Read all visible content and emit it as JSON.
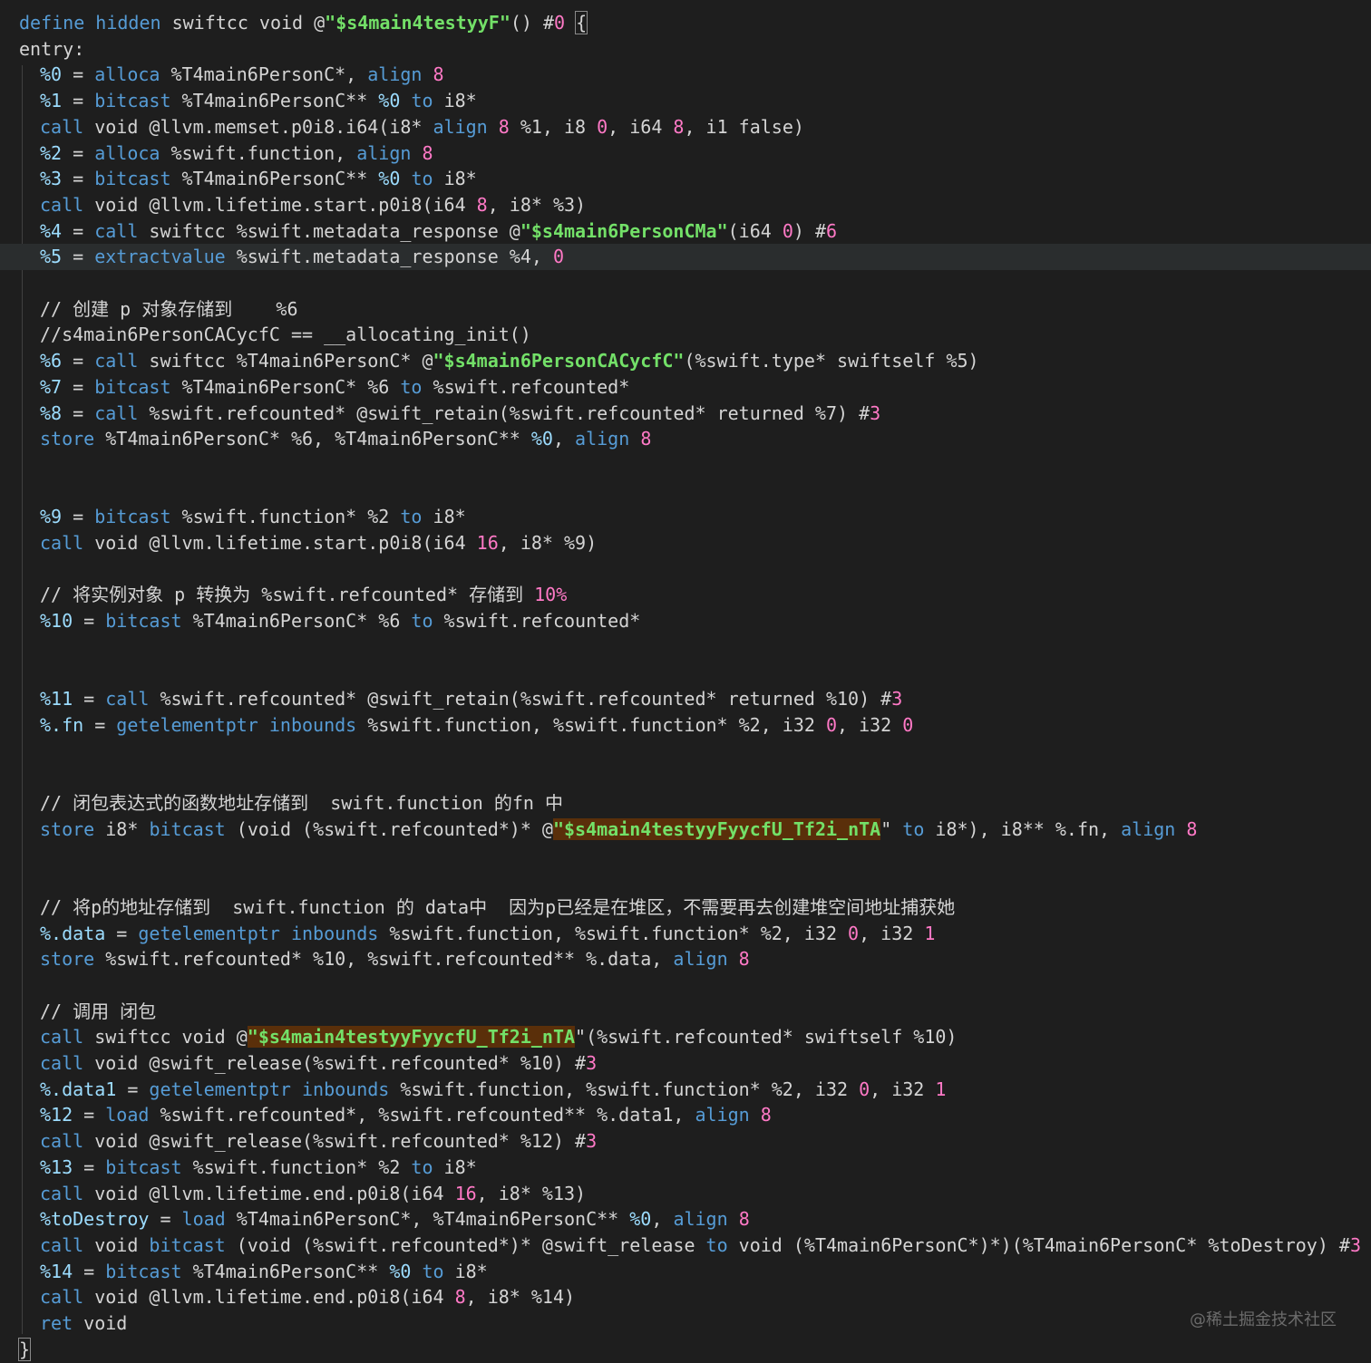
{
  "watermark": "@稀土掘金技术社区",
  "lines": [
    {
      "row": 0,
      "indent": false,
      "tokens": [
        [
          "kw",
          "define hidden"
        ],
        [
          "plain",
          " swiftcc void @"
        ],
        [
          "fn",
          "\"$s4main4testyyF\""
        ],
        [
          "plain",
          "() #"
        ],
        [
          "num",
          "0"
        ],
        [
          "plain",
          " "
        ],
        [
          "br",
          "{"
        ]
      ]
    },
    {
      "row": 1,
      "indent": false,
      "tokens": [
        [
          "plain",
          "entry:"
        ]
      ]
    },
    {
      "row": 2,
      "indent": true,
      "tokens": [
        [
          "var",
          "%0"
        ],
        [
          "plain",
          " = "
        ],
        [
          "kw",
          "alloca"
        ],
        [
          "plain",
          " %T4main6PersonC*, "
        ],
        [
          "kw",
          "align"
        ],
        [
          "plain",
          " "
        ],
        [
          "num",
          "8"
        ]
      ]
    },
    {
      "row": 3,
      "indent": true,
      "tokens": [
        [
          "var",
          "%1"
        ],
        [
          "plain",
          " = "
        ],
        [
          "kw",
          "bitcast"
        ],
        [
          "plain",
          " %T4main6PersonC** "
        ],
        [
          "var",
          "%0"
        ],
        [
          "plain",
          " "
        ],
        [
          "kw",
          "to"
        ],
        [
          "plain",
          " i8*"
        ]
      ]
    },
    {
      "row": 4,
      "indent": true,
      "tokens": [
        [
          "kw",
          "call"
        ],
        [
          "plain",
          " void @llvm.memset.p0i8.i64(i8* "
        ],
        [
          "kw",
          "align"
        ],
        [
          "plain",
          " "
        ],
        [
          "num",
          "8"
        ],
        [
          "plain",
          " %1, i8 "
        ],
        [
          "num",
          "0"
        ],
        [
          "plain",
          ", i64 "
        ],
        [
          "num",
          "8"
        ],
        [
          "plain",
          ", i1 false)"
        ]
      ]
    },
    {
      "row": 5,
      "indent": true,
      "tokens": [
        [
          "var",
          "%2"
        ],
        [
          "plain",
          " = "
        ],
        [
          "kw",
          "alloca"
        ],
        [
          "plain",
          " %swift.function, "
        ],
        [
          "kw",
          "align"
        ],
        [
          "plain",
          " "
        ],
        [
          "num",
          "8"
        ]
      ]
    },
    {
      "row": 6,
      "indent": true,
      "tokens": [
        [
          "var",
          "%3"
        ],
        [
          "plain",
          " = "
        ],
        [
          "kw",
          "bitcast"
        ],
        [
          "plain",
          " %T4main6PersonC** "
        ],
        [
          "var",
          "%0"
        ],
        [
          "plain",
          " "
        ],
        [
          "kw",
          "to"
        ],
        [
          "plain",
          " i8*"
        ]
      ]
    },
    {
      "row": 7,
      "indent": true,
      "tokens": [
        [
          "kw",
          "call"
        ],
        [
          "plain",
          " void @llvm.lifetime.start.p0i8(i64 "
        ],
        [
          "num",
          "8"
        ],
        [
          "plain",
          ", i8* %3)"
        ]
      ]
    },
    {
      "row": 8,
      "indent": true,
      "tokens": [
        [
          "var",
          "%4"
        ],
        [
          "plain",
          " = "
        ],
        [
          "kw",
          "call"
        ],
        [
          "plain",
          " swiftcc %swift.metadata_response @"
        ],
        [
          "fn",
          "\"$s4main6PersonCMa\""
        ],
        [
          "plain",
          "(i64 "
        ],
        [
          "num",
          "0"
        ],
        [
          "plain",
          ") #"
        ],
        [
          "num",
          "6"
        ]
      ]
    },
    {
      "row": 9,
      "indent": true,
      "current": true,
      "tokens": [
        [
          "var",
          "%5"
        ],
        [
          "plain",
          " = "
        ],
        [
          "kw",
          "extractvalue"
        ],
        [
          "plain",
          " %swift.metadata_response %4, "
        ],
        [
          "num",
          "0"
        ]
      ]
    },
    {
      "row": 11,
      "indent": true,
      "tokens": [
        [
          "cm",
          "// 创建 p 对象存储到    %6"
        ]
      ]
    },
    {
      "row": 12,
      "indent": true,
      "tokens": [
        [
          "cm",
          "//s4main6PersonCACycfC == __allocating_init()"
        ]
      ]
    },
    {
      "row": 13,
      "indent": true,
      "tokens": [
        [
          "var",
          "%6"
        ],
        [
          "plain",
          " = "
        ],
        [
          "kw",
          "call"
        ],
        [
          "plain",
          " swiftcc %T4main6PersonC* @"
        ],
        [
          "fn",
          "\"$s4main6PersonCACycfC\""
        ],
        [
          "plain",
          "(%swift.type* swiftself %5)"
        ]
      ]
    },
    {
      "row": 14,
      "indent": true,
      "tokens": [
        [
          "var",
          "%7"
        ],
        [
          "plain",
          " = "
        ],
        [
          "kw",
          "bitcast"
        ],
        [
          "plain",
          " %T4main6PersonC* %6 "
        ],
        [
          "kw",
          "to"
        ],
        [
          "plain",
          " %swift.refcounted*"
        ]
      ]
    },
    {
      "row": 15,
      "indent": true,
      "tokens": [
        [
          "var",
          "%8"
        ],
        [
          "plain",
          " = "
        ],
        [
          "kw",
          "call"
        ],
        [
          "plain",
          " %swift.refcounted* @swift_retain(%swift.refcounted* returned %7) #"
        ],
        [
          "num",
          "3"
        ]
      ]
    },
    {
      "row": 16,
      "indent": true,
      "tokens": [
        [
          "kw",
          "store"
        ],
        [
          "plain",
          " %T4main6PersonC* %6, %T4main6PersonC** "
        ],
        [
          "var",
          "%0"
        ],
        [
          "plain",
          ", "
        ],
        [
          "kw",
          "align"
        ],
        [
          "plain",
          " "
        ],
        [
          "num",
          "8"
        ]
      ]
    },
    {
      "row": 19,
      "indent": true,
      "tokens": [
        [
          "var",
          "%9"
        ],
        [
          "plain",
          " = "
        ],
        [
          "kw",
          "bitcast"
        ],
        [
          "plain",
          " %swift.function* %2 "
        ],
        [
          "kw",
          "to"
        ],
        [
          "plain",
          " i8*"
        ]
      ]
    },
    {
      "row": 20,
      "indent": true,
      "tokens": [
        [
          "kw",
          "call"
        ],
        [
          "plain",
          " void @llvm.lifetime.start.p0i8(i64 "
        ],
        [
          "num",
          "16"
        ],
        [
          "plain",
          ", i8* %9)"
        ]
      ]
    },
    {
      "row": 22,
      "indent": true,
      "tokens": [
        [
          "cm",
          "// 将实例对象 p 转换为 %swift.refcounted* 存储到 "
        ],
        [
          "num",
          "10%"
        ]
      ]
    },
    {
      "row": 23,
      "indent": true,
      "tokens": [
        [
          "var",
          "%10"
        ],
        [
          "plain",
          " = "
        ],
        [
          "kw",
          "bitcast"
        ],
        [
          "plain",
          " %T4main6PersonC* %6 "
        ],
        [
          "kw",
          "to"
        ],
        [
          "plain",
          " %swift.refcounted*"
        ]
      ]
    },
    {
      "row": 26,
      "indent": true,
      "tokens": [
        [
          "var",
          "%11"
        ],
        [
          "plain",
          " = "
        ],
        [
          "kw",
          "call"
        ],
        [
          "plain",
          " %swift.refcounted* @swift_retain(%swift.refcounted* returned %10) #"
        ],
        [
          "num",
          "3"
        ]
      ]
    },
    {
      "row": 27,
      "indent": true,
      "tokens": [
        [
          "var",
          "%.fn"
        ],
        [
          "plain",
          " = "
        ],
        [
          "kw",
          "getelementptr inbounds"
        ],
        [
          "plain",
          " %swift.function, %swift.function* %2, i32 "
        ],
        [
          "num",
          "0"
        ],
        [
          "plain",
          ", i32 "
        ],
        [
          "num",
          "0"
        ]
      ]
    },
    {
      "row": 30,
      "indent": true,
      "tokens": [
        [
          "cm",
          "// 闭包表达式的函数地址存储到  swift.function 的fn 中"
        ]
      ]
    },
    {
      "row": 31,
      "indent": true,
      "tokens": [
        [
          "kw",
          "store"
        ],
        [
          "plain",
          " i8* "
        ],
        [
          "kw",
          "bitcast"
        ],
        [
          "plain",
          " (void (%swift.refcounted*)* @"
        ],
        [
          "hl",
          "\"$s4main4testyyFyycfU_Tf2i_nTA"
        ],
        [
          "plain",
          "\" "
        ],
        [
          "kw",
          "to"
        ],
        [
          "plain",
          " i8*), i8** %.fn, "
        ],
        [
          "kw",
          "align"
        ],
        [
          "plain",
          " "
        ],
        [
          "num",
          "8"
        ]
      ]
    },
    {
      "row": 34,
      "indent": true,
      "tokens": [
        [
          "cm",
          "// 将p的地址存储到  swift.function 的 data中  因为p已经是在堆区，不需要再去创建堆空间地址捕获她"
        ]
      ]
    },
    {
      "row": 35,
      "indent": true,
      "tokens": [
        [
          "var",
          "%.data"
        ],
        [
          "plain",
          " = "
        ],
        [
          "kw",
          "getelementptr inbounds"
        ],
        [
          "plain",
          " %swift.function, %swift.function* %2, i32 "
        ],
        [
          "num",
          "0"
        ],
        [
          "plain",
          ", i32 "
        ],
        [
          "num",
          "1"
        ]
      ]
    },
    {
      "row": 36,
      "indent": true,
      "tokens": [
        [
          "kw",
          "store"
        ],
        [
          "plain",
          " %swift.refcounted* %10, %swift.refcounted** %.data, "
        ],
        [
          "kw",
          "align"
        ],
        [
          "plain",
          " "
        ],
        [
          "num",
          "8"
        ]
      ]
    },
    {
      "row": 38,
      "indent": true,
      "tokens": [
        [
          "cm",
          "// 调用 闭包"
        ]
      ]
    },
    {
      "row": 39,
      "indent": true,
      "tokens": [
        [
          "kw",
          "call"
        ],
        [
          "plain",
          " swiftcc void @"
        ],
        [
          "hl",
          "\"$s4main4testyyFyycfU_Tf2i_nTA"
        ],
        [
          "plain",
          "\"(%swift.refcounted* swiftself %10)"
        ]
      ]
    },
    {
      "row": 40,
      "indent": true,
      "tokens": [
        [
          "kw",
          "call"
        ],
        [
          "plain",
          " void @swift_release(%swift.refcounted* %10) #"
        ],
        [
          "num",
          "3"
        ]
      ]
    },
    {
      "row": 41,
      "indent": true,
      "tokens": [
        [
          "var",
          "%.data1"
        ],
        [
          "plain",
          " = "
        ],
        [
          "kw",
          "getelementptr inbounds"
        ],
        [
          "plain",
          " %swift.function, %swift.function* %2, i32 "
        ],
        [
          "num",
          "0"
        ],
        [
          "plain",
          ", i32 "
        ],
        [
          "num",
          "1"
        ]
      ]
    },
    {
      "row": 42,
      "indent": true,
      "tokens": [
        [
          "var",
          "%12"
        ],
        [
          "plain",
          " = "
        ],
        [
          "kw",
          "load"
        ],
        [
          "plain",
          " %swift.refcounted*, %swift.refcounted** %.data1, "
        ],
        [
          "kw",
          "align"
        ],
        [
          "plain",
          " "
        ],
        [
          "num",
          "8"
        ]
      ]
    },
    {
      "row": 43,
      "indent": true,
      "tokens": [
        [
          "kw",
          "call"
        ],
        [
          "plain",
          " void @swift_release(%swift.refcounted* %12) #"
        ],
        [
          "num",
          "3"
        ]
      ]
    },
    {
      "row": 44,
      "indent": true,
      "tokens": [
        [
          "var",
          "%13"
        ],
        [
          "plain",
          " = "
        ],
        [
          "kw",
          "bitcast"
        ],
        [
          "plain",
          " %swift.function* %2 "
        ],
        [
          "kw",
          "to"
        ],
        [
          "plain",
          " i8*"
        ]
      ]
    },
    {
      "row": 45,
      "indent": true,
      "tokens": [
        [
          "kw",
          "call"
        ],
        [
          "plain",
          " void @llvm.lifetime.end.p0i8(i64 "
        ],
        [
          "num",
          "16"
        ],
        [
          "plain",
          ", i8* %13)"
        ]
      ]
    },
    {
      "row": 46,
      "indent": true,
      "tokens": [
        [
          "var",
          "%toDestroy"
        ],
        [
          "plain",
          " = "
        ],
        [
          "kw",
          "load"
        ],
        [
          "plain",
          " %T4main6PersonC*, %T4main6PersonC** "
        ],
        [
          "var",
          "%0"
        ],
        [
          "plain",
          ", "
        ],
        [
          "kw",
          "align"
        ],
        [
          "plain",
          " "
        ],
        [
          "num",
          "8"
        ]
      ]
    },
    {
      "row": 47,
      "indent": true,
      "tokens": [
        [
          "kw",
          "call"
        ],
        [
          "plain",
          " void "
        ],
        [
          "kw",
          "bitcast"
        ],
        [
          "plain",
          " (void (%swift.refcounted*)* @swift_release "
        ],
        [
          "kw",
          "to"
        ],
        [
          "plain",
          " void (%T4main6PersonC*)*)(%T4main6PersonC* %toDestroy) #"
        ],
        [
          "num",
          "3"
        ]
      ]
    },
    {
      "row": 48,
      "indent": true,
      "tokens": [
        [
          "var",
          "%14"
        ],
        [
          "plain",
          " = "
        ],
        [
          "kw",
          "bitcast"
        ],
        [
          "plain",
          " %T4main6PersonC** "
        ],
        [
          "var",
          "%0"
        ],
        [
          "plain",
          " "
        ],
        [
          "kw",
          "to"
        ],
        [
          "plain",
          " i8*"
        ]
      ]
    },
    {
      "row": 49,
      "indent": true,
      "tokens": [
        [
          "kw",
          "call"
        ],
        [
          "plain",
          " void @llvm.lifetime.end.p0i8(i64 "
        ],
        [
          "num",
          "8"
        ],
        [
          "plain",
          ", i8* %14)"
        ]
      ]
    },
    {
      "row": 50,
      "indent": true,
      "tokens": [
        [
          "kw",
          "ret"
        ],
        [
          "plain",
          " void"
        ]
      ]
    },
    {
      "row": 51,
      "indent": false,
      "tokens": [
        [
          "br",
          "}"
        ]
      ]
    }
  ]
}
